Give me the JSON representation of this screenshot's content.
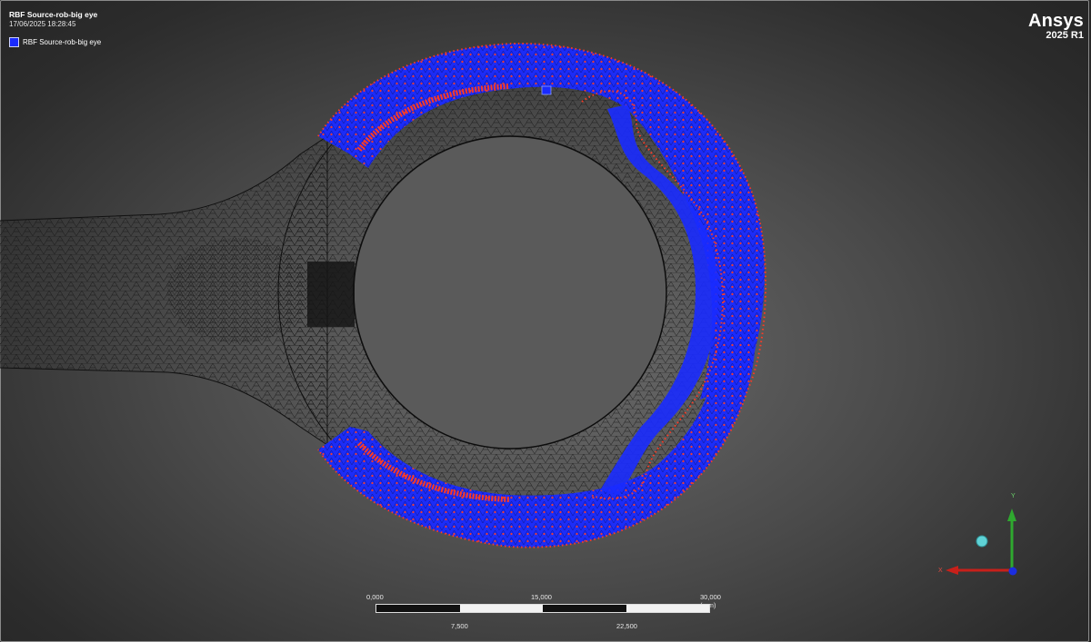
{
  "header": {
    "title": "RBF Source-rob-big eye",
    "timestamp": "17/06/2025 18:28:45"
  },
  "legend": {
    "label": "RBF Source-rob-big eye",
    "color": "#1a2bff"
  },
  "logo": {
    "brand": "Ansys",
    "version": "2025 R1"
  },
  "scale_bar": {
    "top_labels": [
      "0,000",
      "15,000",
      "30,000 (mm)"
    ],
    "bottom_labels": [
      "7,500",
      "22,500"
    ]
  },
  "triad": {
    "y_label": "Y",
    "x_label": "X",
    "y_color": "#2fa82f",
    "x_color": "#c8201a",
    "z_color": "#1b2de0"
  },
  "colors": {
    "mesh": "#141414",
    "rbf_source": "#1a2bff",
    "nodes": "#ff3b24"
  }
}
